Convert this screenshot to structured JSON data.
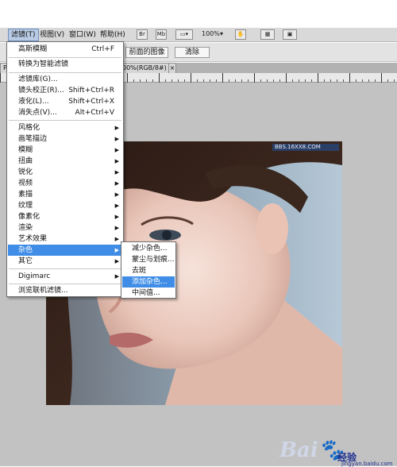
{
  "menubar": {
    "items": [
      "滤镜(T)",
      "视图(V)",
      "窗口(W)",
      "帮助(H)"
    ],
    "buttons": [
      "Br",
      "Mb"
    ],
    "zoom": "100%"
  },
  "options": {
    "front_image": "前面的图像",
    "clear": "清除"
  },
  "tab": {
    "title": "00%(RGB/8#) *",
    "left_stub": "PS"
  },
  "filter_menu": {
    "items": [
      {
        "label": "高斯模糊",
        "shortcut": "Ctrl+F"
      },
      {
        "label": "转换为智能滤镜",
        "shortcut": ""
      },
      {
        "label": "滤镜库(G)...",
        "shortcut": ""
      },
      {
        "label": "镜头校正(R)...",
        "shortcut": "Shift+Ctrl+R"
      },
      {
        "label": "液化(L)...",
        "shortcut": "Shift+Ctrl+X"
      },
      {
        "label": "消失点(V)...",
        "shortcut": "Alt+Ctrl+V"
      },
      {
        "label": "风格化",
        "shortcut": ""
      },
      {
        "label": "画笔描边",
        "shortcut": ""
      },
      {
        "label": "模糊",
        "shortcut": ""
      },
      {
        "label": "扭曲",
        "shortcut": ""
      },
      {
        "label": "锐化",
        "shortcut": ""
      },
      {
        "label": "视频",
        "shortcut": ""
      },
      {
        "label": "素描",
        "shortcut": ""
      },
      {
        "label": "纹理",
        "shortcut": ""
      },
      {
        "label": "像素化",
        "shortcut": ""
      },
      {
        "label": "渲染",
        "shortcut": ""
      },
      {
        "label": "艺术效果",
        "shortcut": ""
      },
      {
        "label": "杂色",
        "shortcut": ""
      },
      {
        "label": "其它",
        "shortcut": ""
      },
      {
        "label": "Digimarc",
        "shortcut": ""
      },
      {
        "label": "浏览联机滤镜...",
        "shortcut": ""
      }
    ]
  },
  "noise_submenu": {
    "items": [
      "减少杂色...",
      "蒙尘与划痕...",
      "去斑",
      "添加杂色...",
      "中间值..."
    ]
  },
  "photo": {
    "watermark": "BBS.16XX8.COM"
  },
  "watermark": {
    "logo": "Bai",
    "brand": "经验",
    "url": "jingyan.baidu.com"
  },
  "colors": {
    "highlight": "#3f8de6",
    "menu_bg": "#ffffff",
    "canvas": "#c2c2c2"
  }
}
